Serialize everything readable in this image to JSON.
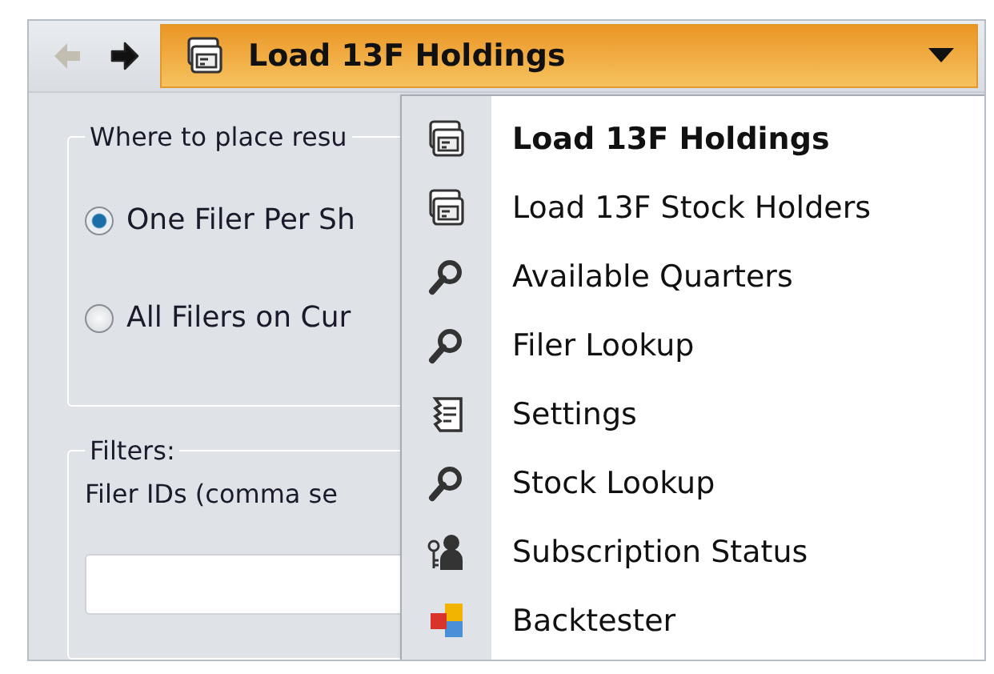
{
  "toolbar": {
    "back": {
      "disabled": true
    },
    "forward": {
      "disabled": false
    },
    "dropdown": {
      "label": "Load 13F Holdings",
      "expanded": true
    }
  },
  "placement": {
    "legend": "Where to place resu",
    "options": [
      {
        "label": "One Filer Per Sh",
        "selected": true
      },
      {
        "label": "All Filers on Cur",
        "selected": false
      }
    ]
  },
  "filters": {
    "legend": "Filters:",
    "label": "Filer IDs (comma se"
  },
  "menu": [
    {
      "label": "Load 13F Holdings",
      "kind": "module",
      "selected": true
    },
    {
      "label": "Load 13F Stock Holders",
      "kind": "module",
      "selected": false
    },
    {
      "label": "Available Quarters",
      "kind": "search",
      "selected": false
    },
    {
      "label": "Filer Lookup",
      "kind": "search",
      "selected": false
    },
    {
      "label": "Settings",
      "kind": "settings",
      "selected": false
    },
    {
      "label": "Stock Lookup",
      "kind": "search",
      "selected": false
    },
    {
      "label": "Subscription Status",
      "kind": "user",
      "selected": false
    },
    {
      "label": "Backtester",
      "kind": "backtester",
      "selected": false
    }
  ]
}
